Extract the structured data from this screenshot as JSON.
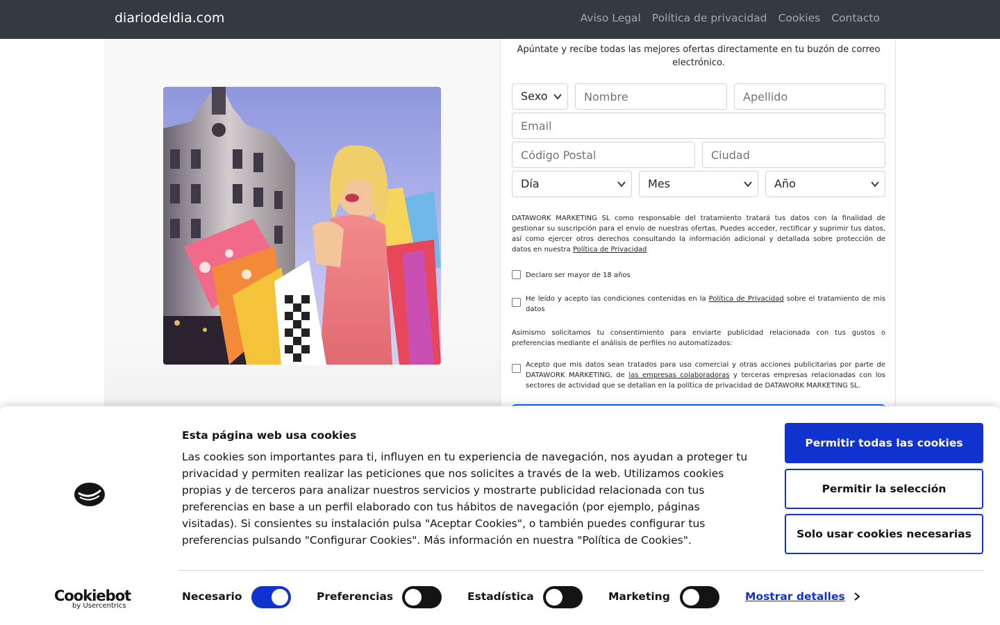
{
  "navbar": {
    "brand": "diariodeldia.com",
    "links": [
      "Aviso Legal",
      "Política de privacidad",
      "Cookies",
      "Contacto"
    ]
  },
  "hero": {
    "image": "woman-shopping-bags-photo"
  },
  "form": {
    "intro": "Apúntate y recibe todas las mejores ofertas directamente en tu buzón de correo electrónico.",
    "sexo": "Sexo",
    "nombre_placeholder": "Nombre",
    "apellido_placeholder": "Apellido",
    "email_placeholder": "Email",
    "cp_placeholder": "Código Postal",
    "ciudad_placeholder": "Ciudad",
    "dia": "Día",
    "mes": "Mes",
    "anio": "Año",
    "legal_text": "DATAWORK MARKETING SL como responsable del tratamiento tratará tus datos con la finalidad de gestionar su suscripción para el envio de nuestras ofertas. Puedes acceder, rectificar y suprimir tus datos, así como ejercer otros derechos consultando la información adicional y detallada sobre protección de datos en nuestra",
    "legal_link": "Política de Privacidad",
    "check_age": "Declaro ser mayor de 18 años",
    "check_privacy_before": "He leído y acepto las condiciones contenidas en la",
    "check_privacy_link": "Política de Privacidad",
    "check_privacy_after": "sobre el tratamiento de mis datos",
    "consent_text": "Asimismo solicitamos tu consentimiento para enviarte publicidad relacionada con tus gustos o preferencias mediante el análisis de perfiles no automatizados:",
    "check_commercial_before": "Acepto que mis datos sean tratados para uso comercial y otras acciones publicitarias por parte de DATAWORK MARKETING, de",
    "check_commercial_link": "las empresas colaboradoras",
    "check_commercial_after": "y terceras empresas relacionadas con los sectores de actividad que se detallan en la política de privacidad de DATAWORK MARKETING SL."
  },
  "cookie": {
    "title": "Esta página web usa cookies",
    "text": "Las cookies son importantes para ti, influyen en tu experiencia de navegación, nos ayudan a proteger tu privacidad y permiten realizar las peticiones que nos solicites a través de la web. Utilizamos cookies propias y de terceros para analizar nuestros servicios y mostrarte publicidad relacionada con tus preferencias en base a un perfil elaborado con tus hábitos de navegación (por ejemplo, páginas visitadas). Si consientes su instalación pulsa \"Aceptar Cookies\", o también puedes configurar tus preferencias pulsando \"Configurar Cookies\". Más información en nuestra \"Política de Cookies\".",
    "btn_all": "Permitir todas las cookies",
    "btn_selection": "Permitir la selección",
    "btn_necessary": "Solo usar cookies necesarias",
    "brand_main": "Cookiebot",
    "brand_sub": "by Usercentrics",
    "toggles": [
      {
        "label": "Necesario",
        "on": true
      },
      {
        "label": "Preferencias",
        "on": false
      },
      {
        "label": "Estadística",
        "on": false
      },
      {
        "label": "Marketing",
        "on": false
      }
    ],
    "details": "Mostrar detalles",
    "accent": "#1032cf"
  }
}
